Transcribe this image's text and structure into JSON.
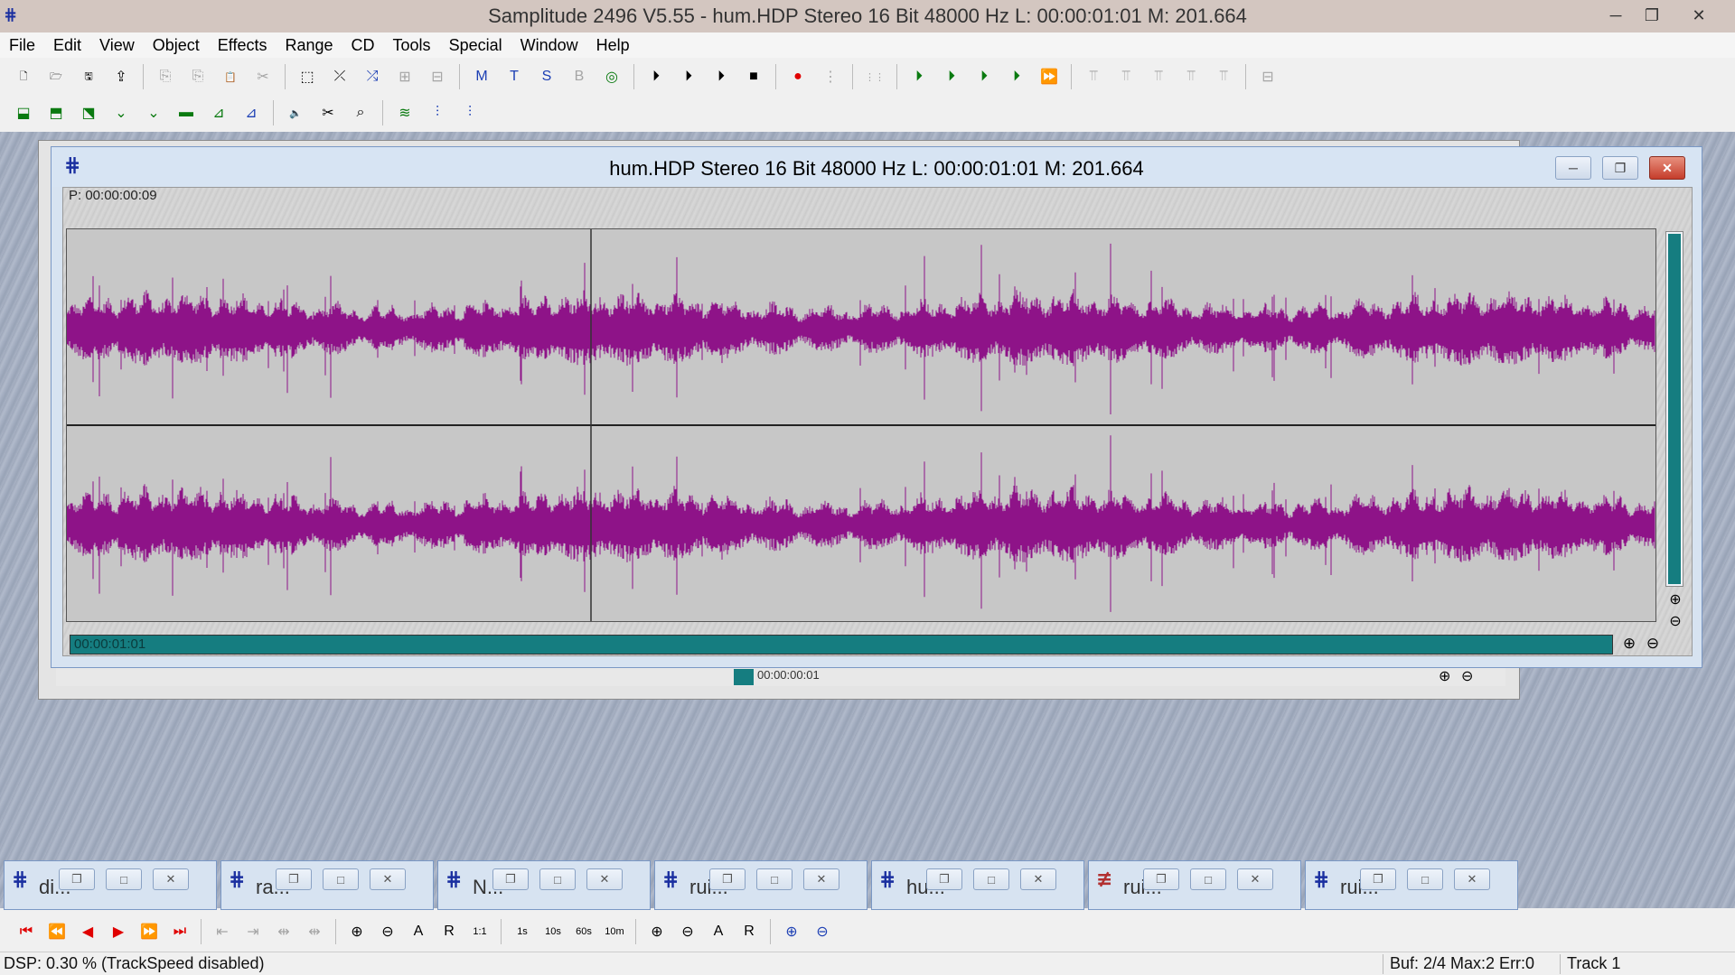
{
  "app": {
    "title": "Samplitude 2496 V5.55 - hum.HDP  Stereo 16 Bit 48000 Hz L: 00:00:01:01 M: 201.664",
    "icon": "waveform-app-icon",
    "controls": {
      "minimize": "─",
      "restore": "❐",
      "close": "✕"
    }
  },
  "menu": [
    "File",
    "Edit",
    "View",
    "Object",
    "Effects",
    "Range",
    "CD",
    "Tools",
    "Special",
    "Window",
    "Help"
  ],
  "toolbar1": [
    {
      "name": "new-project-icon",
      "glyph": "🗋",
      "color": "black"
    },
    {
      "name": "open-project-icon",
      "glyph": "🗁",
      "color": "black"
    },
    {
      "name": "save-project-icon",
      "glyph": "🖫",
      "color": "black"
    },
    {
      "name": "export-icon",
      "glyph": "⇪",
      "color": "black"
    },
    {
      "sep": true
    },
    {
      "name": "copy-icon",
      "glyph": "⎘",
      "color": "gray"
    },
    {
      "name": "copy-range-icon",
      "glyph": "⎘",
      "color": "gray"
    },
    {
      "name": "paste-icon",
      "glyph": "📋",
      "color": "gray"
    },
    {
      "name": "cut-icon",
      "glyph": "✂",
      "color": "gray"
    },
    {
      "sep": true
    },
    {
      "name": "select-range-icon",
      "glyph": "⬚",
      "color": "black"
    },
    {
      "name": "crossfade-icon",
      "glyph": "⤫",
      "color": "black"
    },
    {
      "name": "crossfade-blue-icon",
      "glyph": "⤮",
      "color": "blue"
    },
    {
      "name": "split-icon",
      "glyph": "⊞",
      "color": "gray"
    },
    {
      "name": "trim-icon",
      "glyph": "⊟",
      "color": "gray"
    },
    {
      "sep": true
    },
    {
      "name": "marker-m-icon",
      "glyph": "M",
      "color": "blue"
    },
    {
      "name": "marker-t-icon",
      "glyph": "T",
      "color": "blue"
    },
    {
      "name": "marker-s-icon",
      "glyph": "S",
      "color": "blue"
    },
    {
      "name": "marker-bit-icon",
      "glyph": "B",
      "color": "gray"
    },
    {
      "name": "snap-icon",
      "glyph": "◎",
      "color": "green"
    },
    {
      "sep": true
    },
    {
      "name": "play-from-start-icon",
      "glyph": "⏵",
      "color": "black"
    },
    {
      "name": "play-range-icon",
      "glyph": "⏵",
      "color": "black"
    },
    {
      "name": "play-icon",
      "glyph": "⏵",
      "color": "black"
    },
    {
      "name": "stop-icon",
      "glyph": "■",
      "color": "black"
    },
    {
      "sep": true
    },
    {
      "name": "record-icon",
      "glyph": "●",
      "color": "red"
    },
    {
      "name": "record-options-icon",
      "glyph": "⋮",
      "color": "gray"
    },
    {
      "sep": true
    },
    {
      "name": "mixer-icon",
      "glyph": "⋮⋮",
      "color": "gray"
    },
    {
      "sep": true
    },
    {
      "name": "green-play-1-icon",
      "glyph": "⏵",
      "color": "green"
    },
    {
      "name": "green-play-2-icon",
      "glyph": "⏵",
      "color": "green"
    },
    {
      "name": "green-play-3-icon",
      "glyph": "⏵",
      "color": "green"
    },
    {
      "name": "green-play-4-icon",
      "glyph": "⏵",
      "color": "green"
    },
    {
      "name": "green-fast-forward-icon",
      "glyph": "⏩",
      "color": "green"
    },
    {
      "sep": true
    },
    {
      "name": "volume-1-icon",
      "glyph": "⫪",
      "color": "gray"
    },
    {
      "name": "volume-2-icon",
      "glyph": "⫪",
      "color": "gray"
    },
    {
      "name": "volume-3-icon",
      "glyph": "⫪",
      "color": "gray"
    },
    {
      "name": "volume-4-icon",
      "glyph": "⫪",
      "color": "gray"
    },
    {
      "name": "volume-5-icon",
      "glyph": "⫪",
      "color": "gray"
    },
    {
      "sep": true
    },
    {
      "name": "split-window-icon",
      "glyph": "⊟",
      "color": "gray"
    }
  ],
  "toolbar2": [
    {
      "name": "object-mode-icon",
      "glyph": "⬓",
      "color": "green"
    },
    {
      "name": "range-mode-icon",
      "glyph": "⬒",
      "color": "green"
    },
    {
      "name": "cut-mode-icon",
      "glyph": "⬔",
      "color": "green"
    },
    {
      "name": "volume-curve-icon",
      "glyph": "⌄",
      "color": "green"
    },
    {
      "name": "pan-curve-icon",
      "glyph": "⌄",
      "color": "green"
    },
    {
      "name": "draw-mode-icon",
      "glyph": "▬",
      "color": "green"
    },
    {
      "name": "zoom-mode-icon",
      "glyph": "⊿",
      "color": "green"
    },
    {
      "name": "auto-mode-icon",
      "glyph": "⊿",
      "color": "blue"
    },
    {
      "sep": true
    },
    {
      "name": "speaker-icon",
      "glyph": "🔈",
      "color": "black"
    },
    {
      "name": "scrub-icon",
      "glyph": "✂",
      "color": "black"
    },
    {
      "name": "magnify-icon",
      "glyph": "⌕",
      "color": "black"
    },
    {
      "sep": true
    },
    {
      "name": "grid-on-icon",
      "glyph": "≋",
      "color": "green"
    },
    {
      "name": "grid-mark-icon",
      "glyph": "⫶",
      "color": "blue"
    },
    {
      "name": "grid-settings-icon",
      "glyph": "⫶",
      "color": "blue"
    }
  ],
  "bg_window": {
    "position_label": "00:00:00:01"
  },
  "main_window": {
    "title": "hum.HDP  Stereo 16 Bit 48000 Hz L: 00:00:01:01 M: 201.664",
    "position": "P: 00:00:00:09",
    "hscroll_label": "00:00:01:01",
    "controls": {
      "minimize": "─",
      "restore": "❐",
      "close": "✕"
    }
  },
  "waveform": {
    "color": "#8e1388",
    "background": "#c7c7c7",
    "cursor_fraction": 0.33,
    "channels": 2
  },
  "minimized_windows": [
    {
      "title": "di...",
      "icon": "waveform-icon"
    },
    {
      "title": "ra...",
      "icon": "waveform-icon"
    },
    {
      "title": "N...",
      "icon": "waveform-icon"
    },
    {
      "title": "rui...",
      "icon": "waveform-icon"
    },
    {
      "title": "hu...",
      "icon": "waveform-icon"
    },
    {
      "title": "rui...",
      "icon": "multitrack-icon"
    },
    {
      "title": "rui...",
      "icon": "waveform-icon"
    }
  ],
  "transport": [
    {
      "name": "go-to-start-icon",
      "glyph": "⏮",
      "color": "red"
    },
    {
      "name": "rewind-icon",
      "glyph": "⏪",
      "color": "red"
    },
    {
      "name": "step-back-icon",
      "glyph": "◀",
      "color": "red"
    },
    {
      "name": "step-forward-icon",
      "glyph": "▶",
      "color": "red"
    },
    {
      "name": "fast-forward-icon",
      "glyph": "⏩",
      "color": "red"
    },
    {
      "name": "go-to-end-icon",
      "glyph": "⏭",
      "color": "red"
    },
    {
      "sep": true
    },
    {
      "name": "range-left-icon",
      "glyph": "⇤",
      "color": "gray"
    },
    {
      "name": "range-right-icon",
      "glyph": "⇥",
      "color": "gray"
    },
    {
      "name": "range-shrink-icon",
      "glyph": "⇹",
      "color": "gray"
    },
    {
      "name": "range-expand-icon",
      "glyph": "⇹",
      "color": "gray"
    },
    {
      "sep": true
    },
    {
      "name": "zoom-in-1-icon",
      "glyph": "⊕",
      "color": "black"
    },
    {
      "name": "zoom-out-1-icon",
      "glyph": "⊖",
      "color": "black"
    },
    {
      "name": "zoom-all-icon",
      "glyph": "A",
      "color": "black"
    },
    {
      "name": "zoom-range-icon",
      "glyph": "R",
      "color": "black"
    },
    {
      "name": "zoom-11-icon",
      "glyph": "1:1",
      "color": "black"
    },
    {
      "sep": true
    },
    {
      "name": "zoom-1s-icon",
      "glyph": "1s",
      "color": "black"
    },
    {
      "name": "zoom-10s-icon",
      "glyph": "10s",
      "color": "black"
    },
    {
      "name": "zoom-60s-icon",
      "glyph": "60s",
      "color": "black"
    },
    {
      "name": "zoom-10m-icon",
      "glyph": "10m",
      "color": "black"
    },
    {
      "sep": true
    },
    {
      "name": "vzoom-in-icon",
      "glyph": "⊕",
      "color": "black"
    },
    {
      "name": "vzoom-out-icon",
      "glyph": "⊖",
      "color": "black"
    },
    {
      "name": "vzoom-all-icon",
      "glyph": "A",
      "color": "black"
    },
    {
      "name": "vzoom-range-icon",
      "glyph": "R",
      "color": "black"
    },
    {
      "sep": true
    },
    {
      "name": "zoom-fit-icon",
      "glyph": "⊕",
      "color": "blue"
    },
    {
      "name": "zoom-reset-icon",
      "glyph": "⊖",
      "color": "blue"
    }
  ],
  "status": {
    "left": "DSP: 0.30 %   (TrackSpeed disabled)",
    "buffer": "Buf: 2/4 Max:2 Err:0",
    "track": "Track 1"
  }
}
